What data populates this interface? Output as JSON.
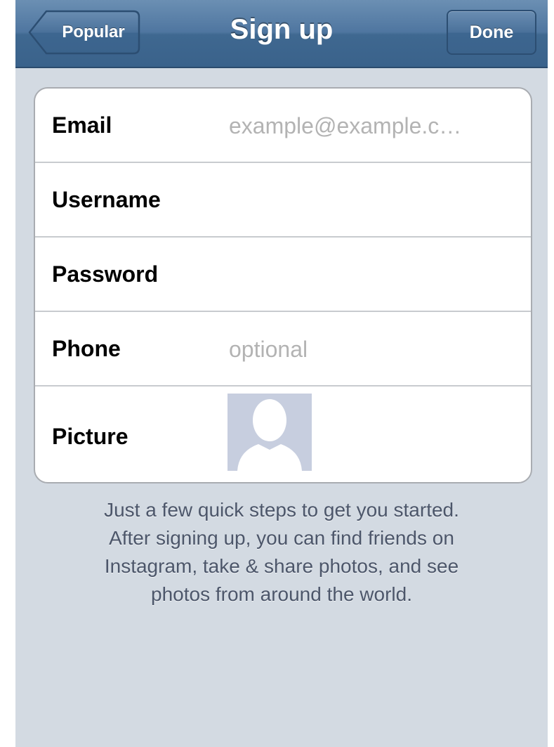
{
  "navbar": {
    "title": "Sign up",
    "back_label": "Popular",
    "done_label": "Done"
  },
  "form": {
    "email": {
      "label": "Email",
      "placeholder": "example@example.c…",
      "value": ""
    },
    "username": {
      "label": "Username",
      "placeholder": "",
      "value": ""
    },
    "password": {
      "label": "Password",
      "placeholder": "",
      "value": ""
    },
    "phone": {
      "label": "Phone",
      "placeholder": "optional",
      "value": ""
    },
    "picture": {
      "label": "Picture",
      "icon": "default-avatar-icon"
    }
  },
  "caption": {
    "lines": [
      "Just a few quick steps to get you started.",
      "After signing up, you can find friends on",
      "Instagram, take & share photos, and see",
      "photos from around the world."
    ]
  },
  "colors": {
    "navbar": "#3f6890",
    "background": "#d3dae2",
    "avatar": "#c7cedf"
  }
}
